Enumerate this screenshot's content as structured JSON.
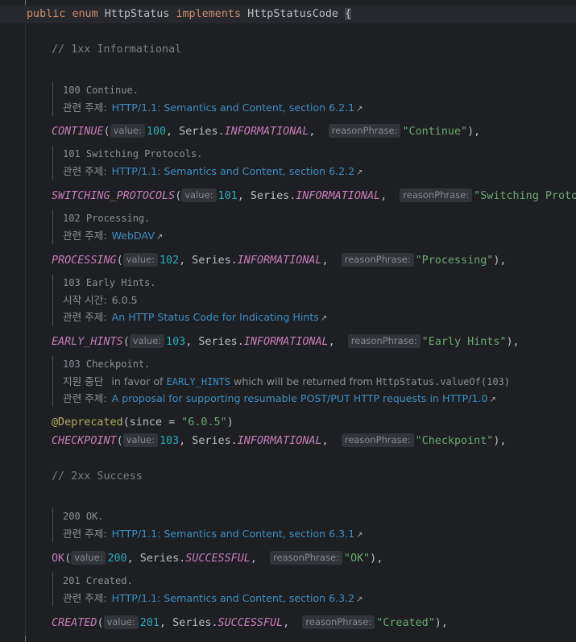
{
  "header": {
    "kw_public": "public",
    "kw_enum": "enum",
    "class_name": "HttpStatus",
    "kw_implements": "implements",
    "iface_name": "HttpStatusCode",
    "brace": "{"
  },
  "labels": {
    "see_also": "관련 주제:",
    "since": "시작 시간:",
    "deprecated": "지원 중단",
    "value_hint": "value:",
    "reason_hint": "reasonPhrase:",
    "series_prefix": "Series.",
    "arrow": "↗"
  },
  "comments": {
    "informational": "// 1xx Informational",
    "success": "// 2xx Success"
  },
  "entries": [
    {
      "doc_title": "100 Continue.",
      "link": "HTTP/1.1: Semantics and Content, section 6.2.1",
      "name": "CONTINUE",
      "value": "100",
      "series": "INFORMATIONAL",
      "reason": "\"Continue\"",
      "tail": "),"
    },
    {
      "doc_title": "101 Switching Protocols.",
      "link": "HTTP/1.1: Semantics and Content, section 6.2.2",
      "name": "SWITCHING_PROTOCOLS",
      "value": "101",
      "series": "INFORMATIONAL",
      "reason": "\"Switching Protoc"
    },
    {
      "doc_title": "102 Processing.",
      "link": "WebDAV",
      "name": "PROCESSING",
      "value": "102",
      "series": "INFORMATIONAL",
      "reason": "\"Processing\"",
      "tail": "),"
    },
    {
      "doc_title": "103 Early Hints.",
      "since": "6.0.5",
      "link": "An HTTP Status Code for Indicating Hints",
      "name": "EARLY_HINTS",
      "value": "103",
      "series": "INFORMATIONAL",
      "reason": "\"Early Hints\"",
      "tail": "),"
    },
    {
      "doc_title": "103 Checkpoint.",
      "deprecated_pre": "in favor of",
      "deprecated_code": "EARLY_HINTS",
      "deprecated_mid": "which will be returned from",
      "deprecated_call": "HttpStatus.valueOf(103)",
      "link": "A proposal for supporting resumable POST/PUT HTTP requests in HTTP/1.0",
      "annotation": "@Deprecated",
      "annotation_args_open": "(since = ",
      "annotation_value": "\"6.0.5\"",
      "annotation_args_close": ")",
      "name": "CHECKPOINT",
      "value": "103",
      "series": "INFORMATIONAL",
      "reason": "\"Checkpoint\"",
      "tail": "),"
    },
    {
      "doc_title": "200 OK.",
      "link": "HTTP/1.1: Semantics and Content, section 6.3.1",
      "name": "OK",
      "value": "200",
      "series": "SUCCESSFUL",
      "reason": "\"OK\"",
      "tail": "),"
    },
    {
      "doc_title": "201 Created.",
      "link": "HTTP/1.1: Semantics and Content, section 6.3.2",
      "name": "CREATED",
      "value": "201",
      "series": "SUCCESSFUL",
      "reason": "\"Created\"",
      "tail": "),"
    }
  ],
  "colors": {
    "background": "#1e1f22",
    "keyword": "#cf8e6d",
    "enum_constant": "#c77dbb",
    "number": "#2aacb8",
    "string": "#6aab73",
    "comment": "#7a7e85",
    "link": "#3d8fc2",
    "annotation": "#b3ae60"
  }
}
